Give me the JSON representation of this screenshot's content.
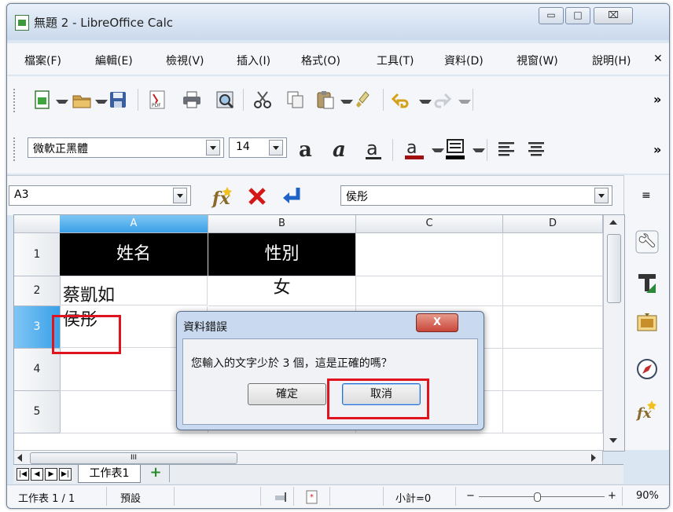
{
  "window": {
    "title": "無題 2 - LibreOffice Calc",
    "minimize_glyph": "▭",
    "restore_glyph": "□",
    "close_glyph": "⌧"
  },
  "menu": {
    "items": [
      "檔案(F)",
      "編輯(E)",
      "檢視(V)",
      "插入(I)",
      "格式(O)",
      "工具(T)",
      "資料(D)",
      "視窗(W)",
      "說明(H)"
    ],
    "close_glyph": "✕"
  },
  "toolbar_more": "»",
  "format_bar": {
    "font_name": "微軟正黑體",
    "font_size": "14"
  },
  "formula_bar": {
    "name_box": "A3",
    "content": "侯彤",
    "side_glyph": "≡"
  },
  "sheet": {
    "columns": [
      "A",
      "B",
      "C",
      "D"
    ],
    "rows": [
      "1",
      "2",
      "3",
      "4",
      "5"
    ],
    "cells": {
      "A1": "姓名",
      "B1": "性別",
      "A2": "蔡凱如",
      "B2": "女",
      "A3": "侯彤"
    },
    "scroll_marker": "III"
  },
  "tabs": {
    "sheet_name": "工作表1",
    "add_glyph": "+"
  },
  "status": {
    "sheet_pos": "工作表 1 / 1",
    "page_style": "預設",
    "sum": "小計=0",
    "zoom_minus": "−",
    "zoom_plus": "+",
    "zoom": "90%"
  },
  "dialog": {
    "title": "資料錯誤",
    "close_glyph": "X",
    "message": "您輸入的文字少於 3 個，這是正確的嗎？",
    "ok_label": "確定",
    "cancel_label": "取消"
  },
  "colors": {
    "highlight_red": "#e0141e",
    "header_fill": "#000000",
    "selection_blue": "#3aa0e8"
  }
}
